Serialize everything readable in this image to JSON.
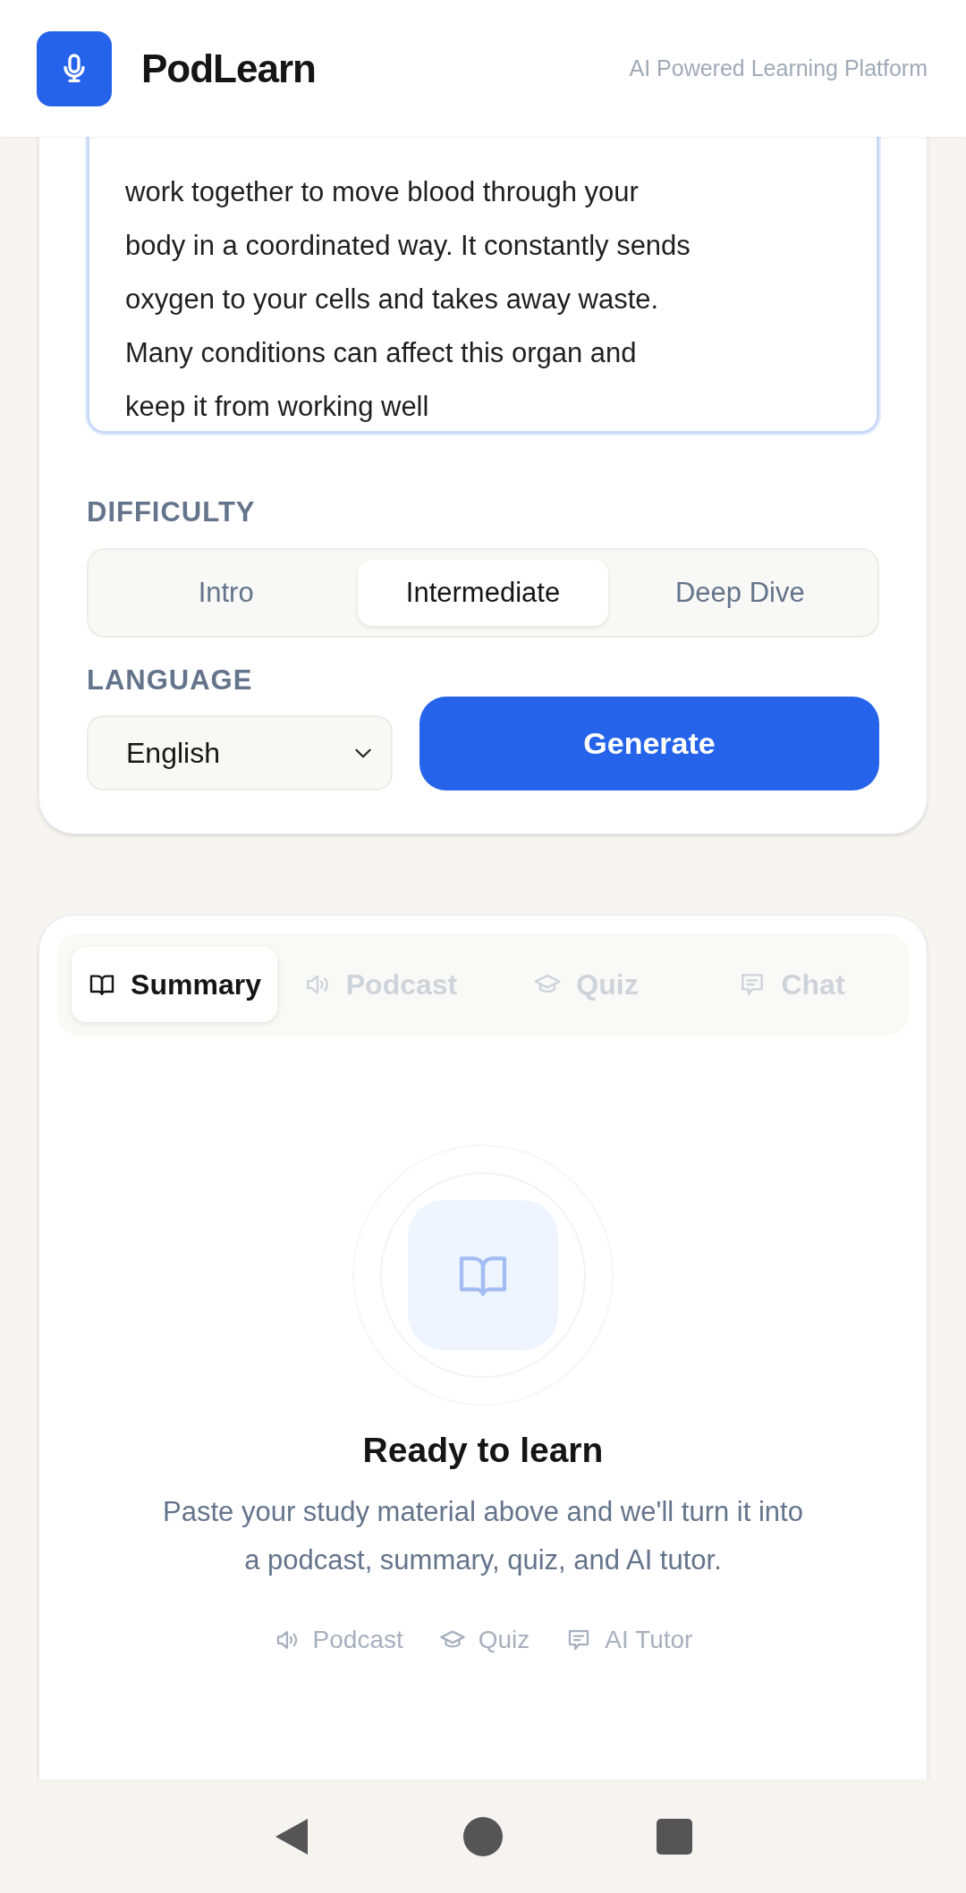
{
  "header": {
    "app_name": "PodLearn",
    "tagline": "AI Powered Learning Platform"
  },
  "input": {
    "value": "work together to move blood through your\nbody in a coordinated way. It constantly sends\noxygen to your cells and takes away waste.\nMany conditions can affect this organ and\nkeep it from working well"
  },
  "difficulty": {
    "label": "DIFFICULTY",
    "options": [
      {
        "label": "Intro",
        "selected": false
      },
      {
        "label": "Intermediate",
        "selected": true
      },
      {
        "label": "Deep Dive",
        "selected": false
      }
    ]
  },
  "language": {
    "label": "LANGUAGE",
    "value": "English"
  },
  "generate_button": "Generate",
  "output": {
    "tabs": [
      {
        "label": "Summary",
        "selected": true
      },
      {
        "label": "Podcast",
        "selected": false
      },
      {
        "label": "Quiz",
        "selected": false
      },
      {
        "label": "Chat",
        "selected": false
      }
    ],
    "empty_state": {
      "title": "Ready to learn",
      "message": "Paste your study material above and we'll turn it into a podcast, summary, quiz, and AI tutor.",
      "features": [
        "Podcast",
        "Quiz",
        "AI Tutor"
      ]
    }
  }
}
